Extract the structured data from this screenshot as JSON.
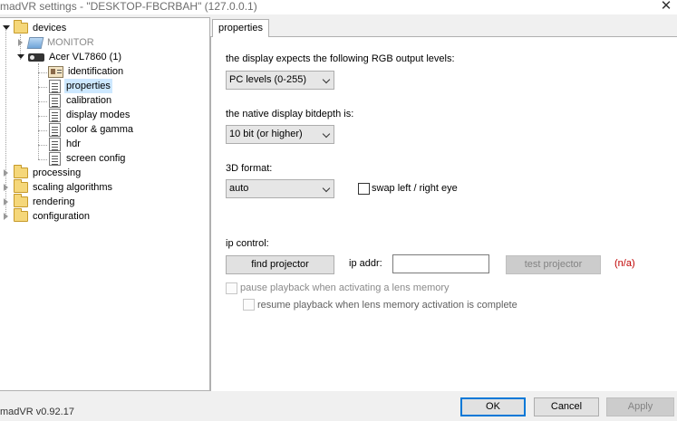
{
  "window": {
    "title": "madVR settings - \"DESKTOP-FBCRBAH\" (127.0.0.1)",
    "close_icon": "close-icon"
  },
  "tree": {
    "devices": "devices",
    "monitor": "MONITOR",
    "acer": "Acer VL7860 (1)",
    "children": [
      "identification",
      "properties",
      "calibration",
      "display modes",
      "color & gamma",
      "hdr",
      "screen config"
    ],
    "processing": "processing",
    "scaling": "scaling algorithms",
    "rendering": "rendering",
    "configuration": "configuration",
    "selected": "properties"
  },
  "tab": {
    "label": "properties"
  },
  "props": {
    "rgb_label": "the display expects the following RGB output levels:",
    "rgb_value": "PC levels (0-255)",
    "bitdepth_label": "the native display bitdepth is:",
    "bitdepth_value": "10 bit (or higher)",
    "format_label": "3D format:",
    "format_value": "auto",
    "swap_label": "swap left / right eye",
    "ip_label": "ip control:",
    "find_projector": "find projector",
    "ip_addr_label": "ip addr:",
    "ip_addr_value": "",
    "test_projector": "test projector",
    "na": "(n/a)",
    "pause_label": "pause playback when activating a lens memory",
    "resume_label": "resume playback when lens memory activation is complete"
  },
  "footer": {
    "version": "madVR v0.92.17",
    "ok": "OK",
    "cancel": "Cancel",
    "apply": "Apply"
  },
  "colors": {
    "selection": "#cde8ff",
    "na_text": "#c00000",
    "default_button_border": "#0078d7"
  }
}
